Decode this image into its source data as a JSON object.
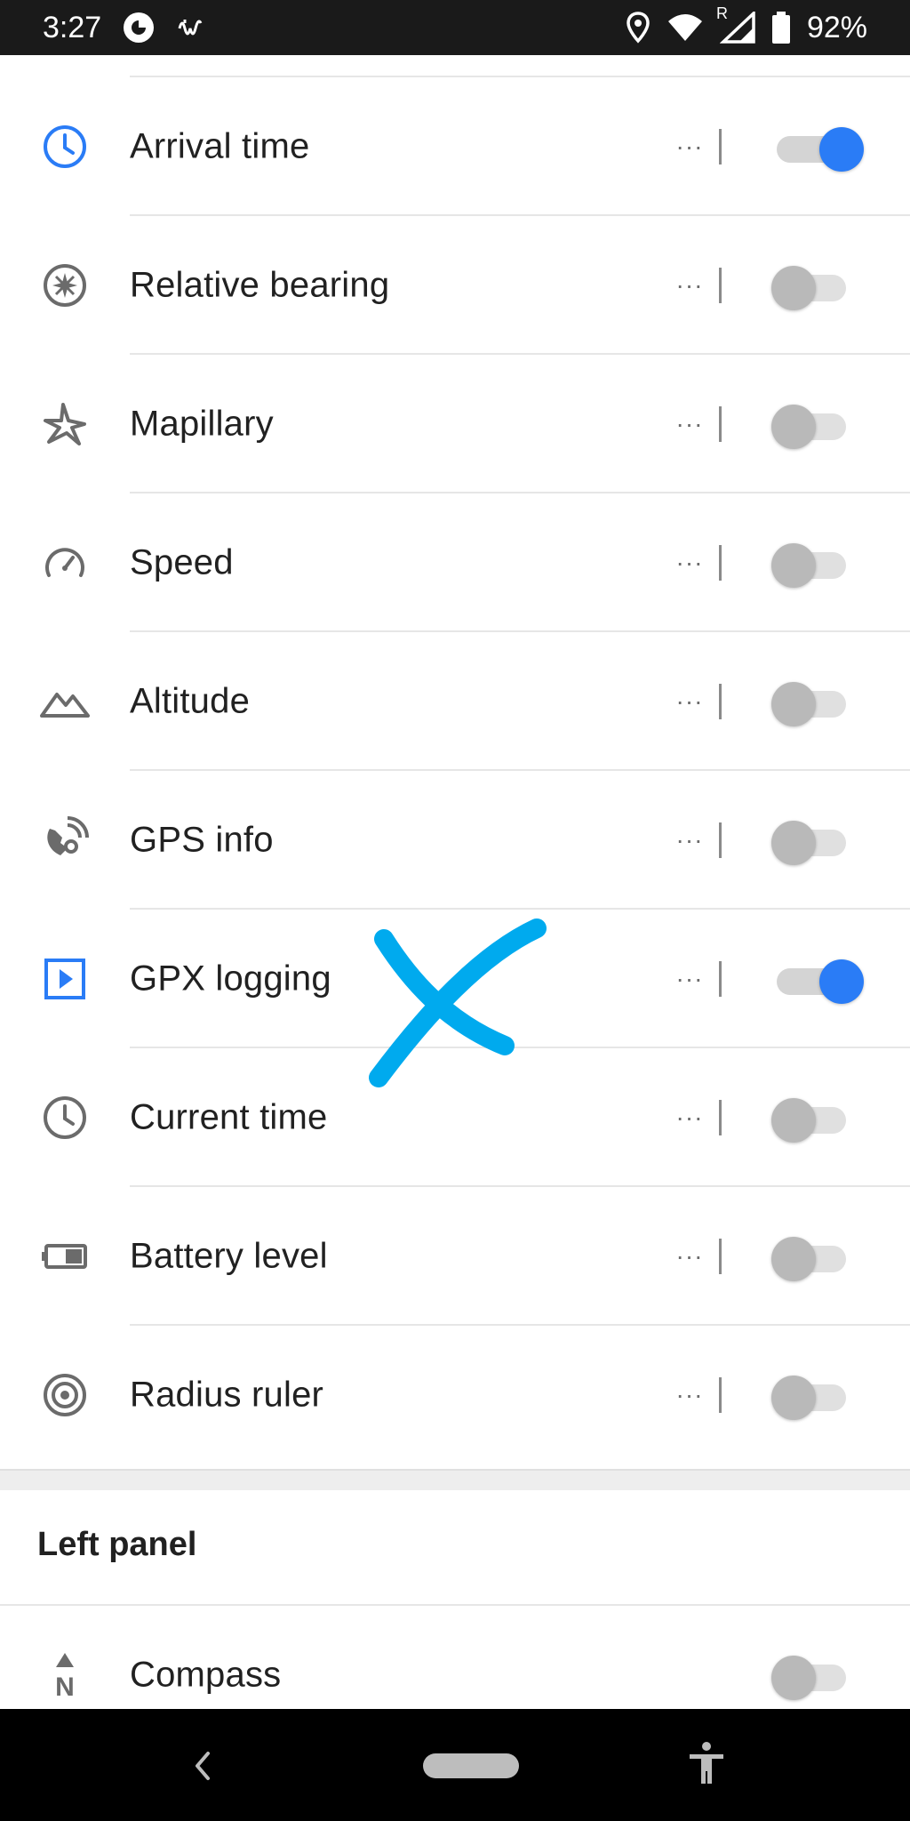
{
  "status_bar": {
    "time": "3:27",
    "battery_percent": "92%",
    "roaming_indicator": "R",
    "icons": [
      "app-notification-icon",
      "waveform-icon",
      "location-pin-icon",
      "wifi-icon",
      "signal-icon",
      "battery-icon"
    ]
  },
  "widgets": [
    {
      "label": "Arrival time",
      "icon": "clock-icon",
      "enabled": true,
      "more": "···"
    },
    {
      "label": "Relative bearing",
      "icon": "compass-bearing-icon",
      "enabled": false,
      "more": "···"
    },
    {
      "label": "Mapillary",
      "icon": "mapillary-icon",
      "enabled": false,
      "more": "···"
    },
    {
      "label": "Speed",
      "icon": "speedometer-icon",
      "enabled": false,
      "more": "···"
    },
    {
      "label": "Altitude",
      "icon": "mountain-icon",
      "enabled": false,
      "more": "···"
    },
    {
      "label": "GPS info",
      "icon": "satellite-icon",
      "enabled": false,
      "more": "···"
    },
    {
      "label": "GPX logging",
      "icon": "play-square-icon",
      "enabled": true,
      "more": "···"
    },
    {
      "label": "Current time",
      "icon": "clock-icon",
      "enabled": false,
      "more": "···"
    },
    {
      "label": "Battery level",
      "icon": "battery-level-icon",
      "enabled": false,
      "more": "···"
    },
    {
      "label": "Radius ruler",
      "icon": "target-icon",
      "enabled": false,
      "more": "···"
    }
  ],
  "left_panel": {
    "title": "Left panel",
    "items": [
      {
        "label": "Compass",
        "icon": "compass-north-icon",
        "enabled": false
      }
    ]
  },
  "colors": {
    "accent": "#2a7cf6",
    "annotation": "#00aaee",
    "icon_gray": "#6b6b6b"
  }
}
